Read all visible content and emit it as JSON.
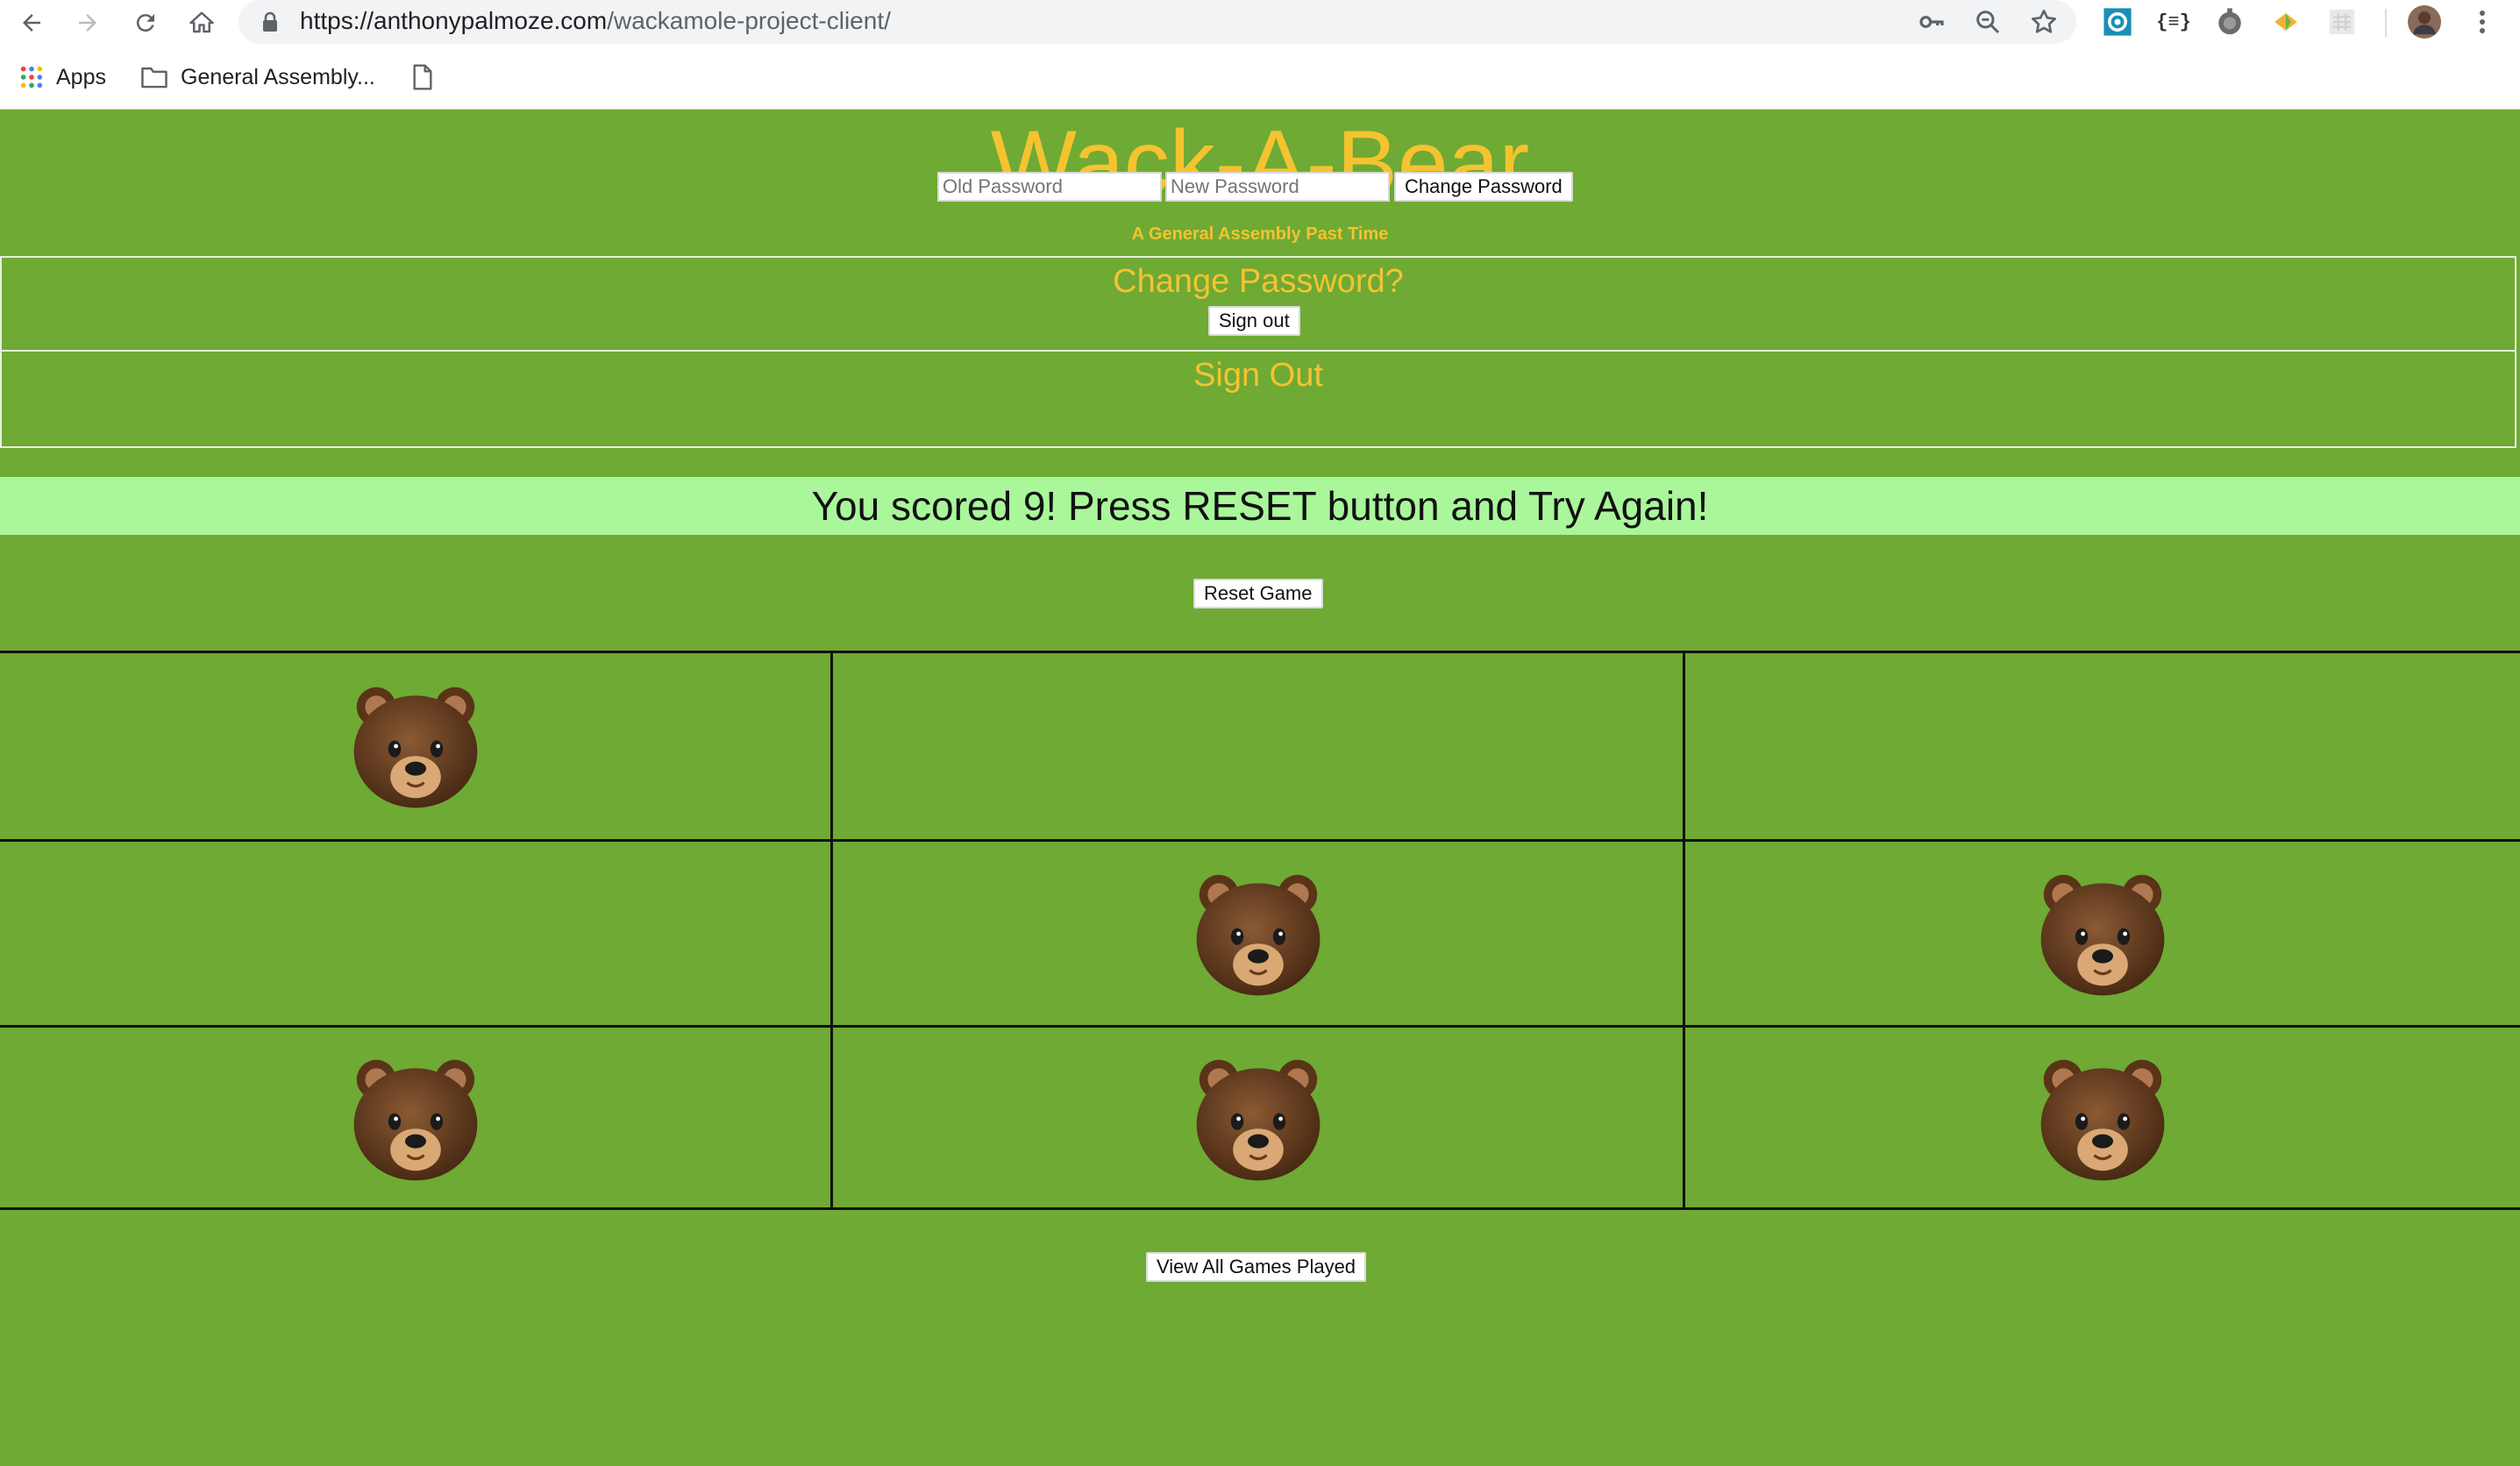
{
  "browser": {
    "url_host": "https://anthonypalmoze.com",
    "url_path": "/wackamole-project-client/",
    "bookmarks": [
      "Apps",
      "General Assembly..."
    ]
  },
  "app": {
    "title": "Wack-A-Bear",
    "subtitle": "A General Assembly Past Time"
  },
  "change_password": {
    "heading": "Change Password?",
    "old_placeholder": "Old Password",
    "new_placeholder": "New Password",
    "button": "Change Password"
  },
  "sign_out": {
    "heading": "Sign Out",
    "button": "Sign out"
  },
  "game": {
    "message": "You scored 9! Press RESET button and Try Again!",
    "reset_button": "Reset Game",
    "board": [
      [
        true,
        false,
        false
      ],
      [
        false,
        true,
        true
      ],
      [
        true,
        true,
        true
      ]
    ],
    "history_button": "View All Games Played"
  },
  "colors": {
    "background": "#6eaa34",
    "title": "#f5c330",
    "message_bar": "#a9f79a"
  }
}
